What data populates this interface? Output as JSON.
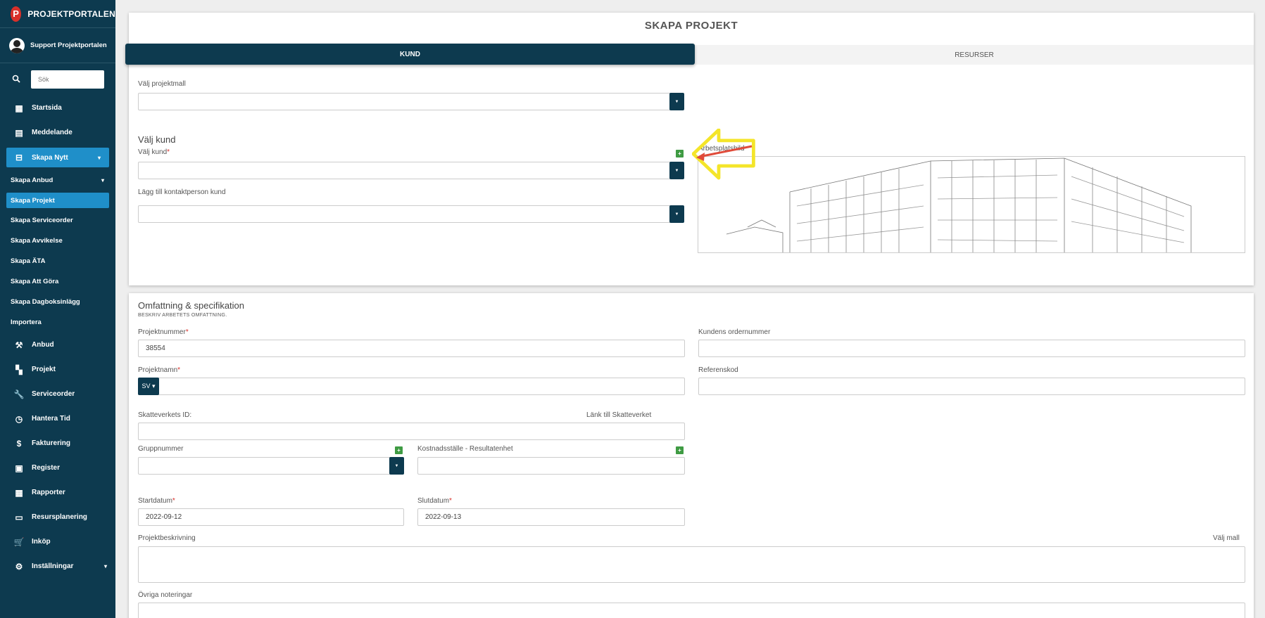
{
  "sidebar": {
    "brand": "PROJEKTPORTALEN",
    "user": "Support Projektportalen",
    "search_placeholder": "Sök",
    "nav_top": [
      {
        "label": "Startsida",
        "icon": "dashboard-icon"
      },
      {
        "label": "Meddelande",
        "icon": "message-icon"
      }
    ],
    "skapa_nytt": "Skapa Nytt",
    "sub": {
      "skapa_anbud": "Skapa Anbud",
      "skapa_projekt": "Skapa Projekt",
      "skapa_serviceorder": "Skapa Serviceorder",
      "skapa_avvikelse": "Skapa Avvikelse",
      "skapa_ata": "Skapa ÄTA",
      "skapa_att_gora": "Skapa Att Göra",
      "skapa_dagbok": "Skapa Dagboksinlägg",
      "importera": "Importera"
    },
    "nav_bottom": [
      {
        "label": "Anbud",
        "icon": "gavel-icon"
      },
      {
        "label": "Projekt",
        "icon": "grid-icon"
      },
      {
        "label": "Serviceorder",
        "icon": "wrench-icon"
      },
      {
        "label": "Hantera Tid",
        "icon": "clock-icon"
      },
      {
        "label": "Fakturering",
        "icon": "dollar-icon"
      },
      {
        "label": "Register",
        "icon": "image-icon"
      },
      {
        "label": "Rapporter",
        "icon": "calendar-icon"
      },
      {
        "label": "Resursplanering",
        "icon": "calendar-blank-icon"
      },
      {
        "label": "Inköp",
        "icon": "cart-icon"
      },
      {
        "label": "Inställningar",
        "icon": "gear-icon"
      }
    ]
  },
  "page": {
    "title": "SKAPA PROJEKT",
    "tabs": {
      "kund": "KUND",
      "resurser": "RESURSER"
    }
  },
  "kund": {
    "projektmall_label": "Välj projektmall",
    "valj_kund_heading": "Välj kund",
    "valj_kund_label": "Välj kund",
    "kontakt_label": "Lägg till kontaktperson kund",
    "arbetsplatsbild_label": "Arbetsplatsbild"
  },
  "omfattning": {
    "heading": "Omfattning & specifikation",
    "caption": "BESKRIV ARBETETS OMFATTNING.",
    "projektnummer_label": "Projektnummer",
    "projektnummer_value": "38554",
    "kundens_ordernummer_label": "Kundens ordernummer",
    "projektnamn_label": "Projektnamn",
    "lang_btn": "SV ▾",
    "referenskod_label": "Referenskod",
    "skatteverket_label": "Skatteverkets ID:",
    "skatteverket_link": "Länk till Skatteverket",
    "gruppnummer_label": "Gruppnummer",
    "kostnadsstalle_label": "Kostnadsställe - Resultatenhet",
    "startdatum_label": "Startdatum",
    "startdatum_value": "2022-09-12",
    "slutdatum_label": "Slutdatum",
    "slutdatum_value": "2022-09-13",
    "beskrivning_label": "Projektbeskrivning",
    "valj_mall": "Välj mall",
    "ovriga_label": "Övriga noteringar"
  },
  "colors": {
    "primary": "#0d3a4f",
    "accent": "#1f8fc9",
    "add": "#3f9b43",
    "required": "#d8302a"
  }
}
